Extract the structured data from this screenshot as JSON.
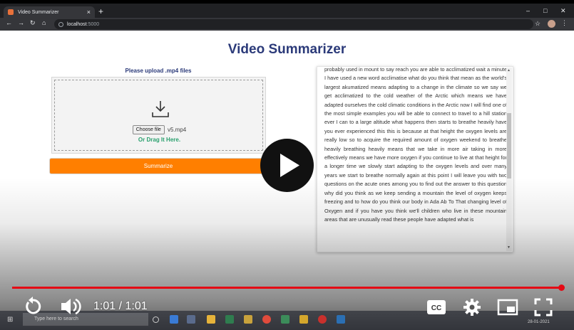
{
  "browser": {
    "tab_title": "Video Summarizer",
    "tab_close": "×",
    "new_tab": "+",
    "url_host": "localhost",
    "url_port": ":5000"
  },
  "page": {
    "title": "Video Summarizer",
    "upload_label": "Please upload .mp4 files",
    "choose_file_label": "Choose file",
    "file_name": "v5.mp4",
    "drag_text": "Or Drag It Here.",
    "summarize_label": "Summarize",
    "summary_text": "probably used in mount to say reach you are able to acclimatized wait a minute I have used a new word acclimatise what do you think that mean as the world's largest akumatized means adapting to a change in the climate so we say we get acclimatized to the cold weather of the Arctic which means we have adapted ourselves the cold climatic conditions in the Arctic now I will find one of the most simple examples you will be able to connect to travel to a hill station ever I can to a large altitude what happens then starts to breathe heavily have you ever experienced this this is because at that height the oxygen levels are really low so to acquire the required amount of oxygen weekend to breathe heavily breathing heavily means that we take in more air taking in more effectively means we have more oxygen if you continue to live at that height for a longer time we slowly start adapting to the oxygen levels and over many years we start to breathe normally again at this point I will leave you with two questions on the acute ones among you to find out the answer to this question why did you think as we keep sending a mountain the level of oxygen keeps freezing and to how do you think our body in Ada Ab To That changing level of Oxygen and if you have you think we'll children who live in these mountain areas that are unusually read these people have adapted what is"
  },
  "taskbar": {
    "search_placeholder": "Type here to search",
    "date": "28-01-2021"
  },
  "video": {
    "time_display": "1:01 / 1:01",
    "progress": 1.0
  },
  "colors": {
    "title": "#2b3a79",
    "accent_button": "#ff7f00",
    "drag_text": "#2aa06e",
    "progress": "#e50914"
  }
}
